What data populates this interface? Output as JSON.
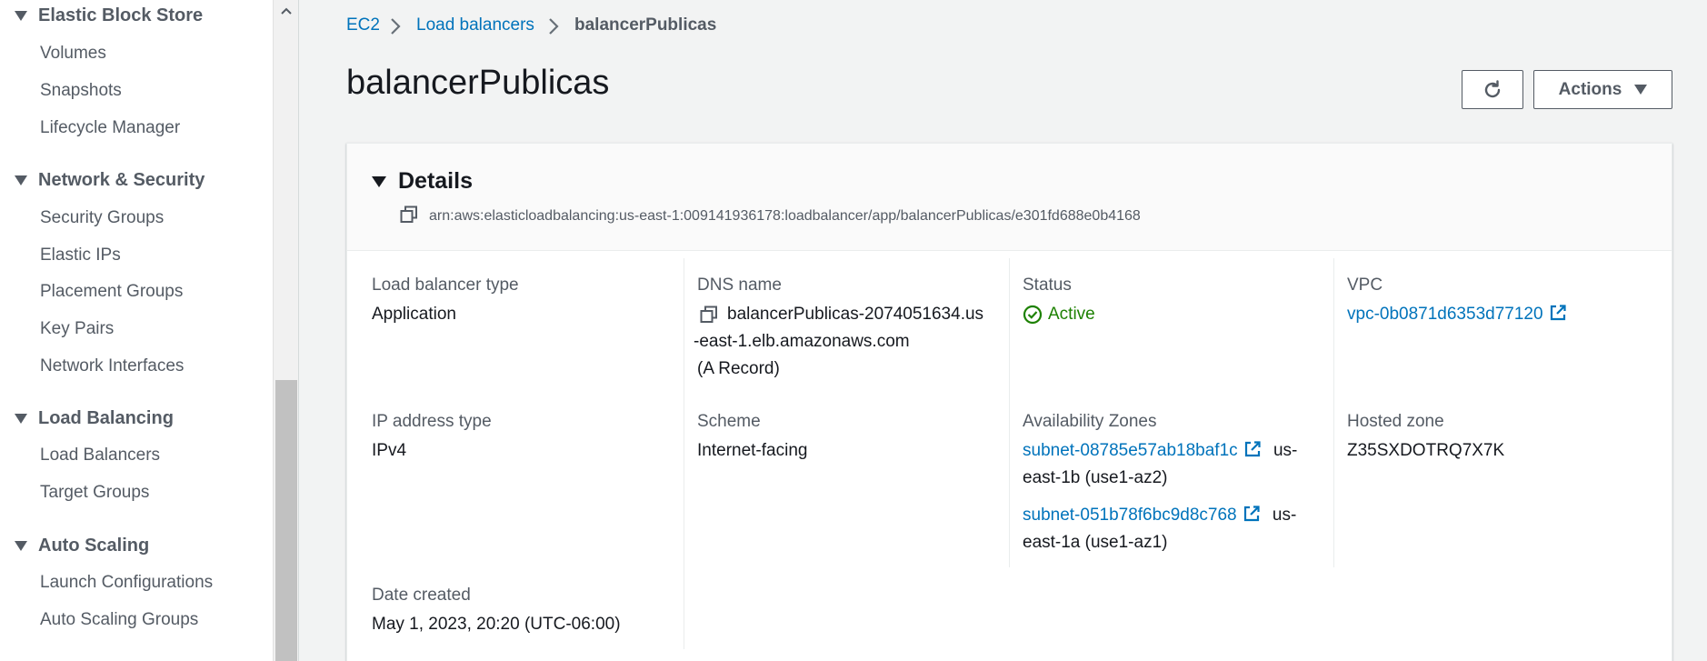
{
  "sidebar": {
    "sections": [
      {
        "title": "Elastic Block Store",
        "items": [
          "Volumes",
          "Snapshots",
          "Lifecycle Manager"
        ]
      },
      {
        "title": "Network & Security",
        "items": [
          "Security Groups",
          "Elastic IPs",
          "Placement Groups",
          "Key Pairs",
          "Network Interfaces"
        ]
      },
      {
        "title": "Load Balancing",
        "items": [
          "Load Balancers",
          "Target Groups"
        ]
      },
      {
        "title": "Auto Scaling",
        "items": [
          "Launch Configurations",
          "Auto Scaling Groups"
        ]
      }
    ]
  },
  "breadcrumb": {
    "items": [
      "EC2",
      "Load balancers",
      "balancerPublicas"
    ]
  },
  "page": {
    "title": "balancerPublicas",
    "actions_label": "Actions"
  },
  "details": {
    "title": "Details",
    "arn": "arn:aws:elasticloadbalancing:us-east-1:009141936178:loadbalancer/app/balancerPublicas/e301fd688e0b4168",
    "fields": {
      "lb_type": {
        "label": "Load balancer type",
        "value": "Application"
      },
      "dns": {
        "label": "DNS name",
        "line1": "balancerPublicas-2074051634.us",
        "line2": "-east-1.elb.amazonaws.com",
        "line3": "(A Record)"
      },
      "status": {
        "label": "Status",
        "value": "Active"
      },
      "vpc": {
        "label": "VPC",
        "value": "vpc-0b0871d6353d77120"
      },
      "ip_type": {
        "label": "IP address type",
        "value": "IPv4"
      },
      "scheme": {
        "label": "Scheme",
        "value": "Internet-facing"
      },
      "az": {
        "label": "Availability Zones",
        "subnets": [
          {
            "id": "subnet-08785e57ab18baf1c",
            "zone_a": "us-",
            "zone_b": "east-1b (use1-az2)"
          },
          {
            "id": "subnet-051b78f6bc9d8c768",
            "zone_a": "us-",
            "zone_b": "east-1a (use1-az1)"
          }
        ]
      },
      "hosted_zone": {
        "label": "Hosted zone",
        "value": "Z35SXDOTRQ7X7K"
      },
      "date_created": {
        "label": "Date created",
        "value": "May 1, 2023, 20:20 (UTC-06:00)"
      }
    }
  },
  "colors": {
    "link": "#0073bb",
    "success": "#1d8102",
    "text": "#16191f",
    "muted": "#545b64"
  }
}
